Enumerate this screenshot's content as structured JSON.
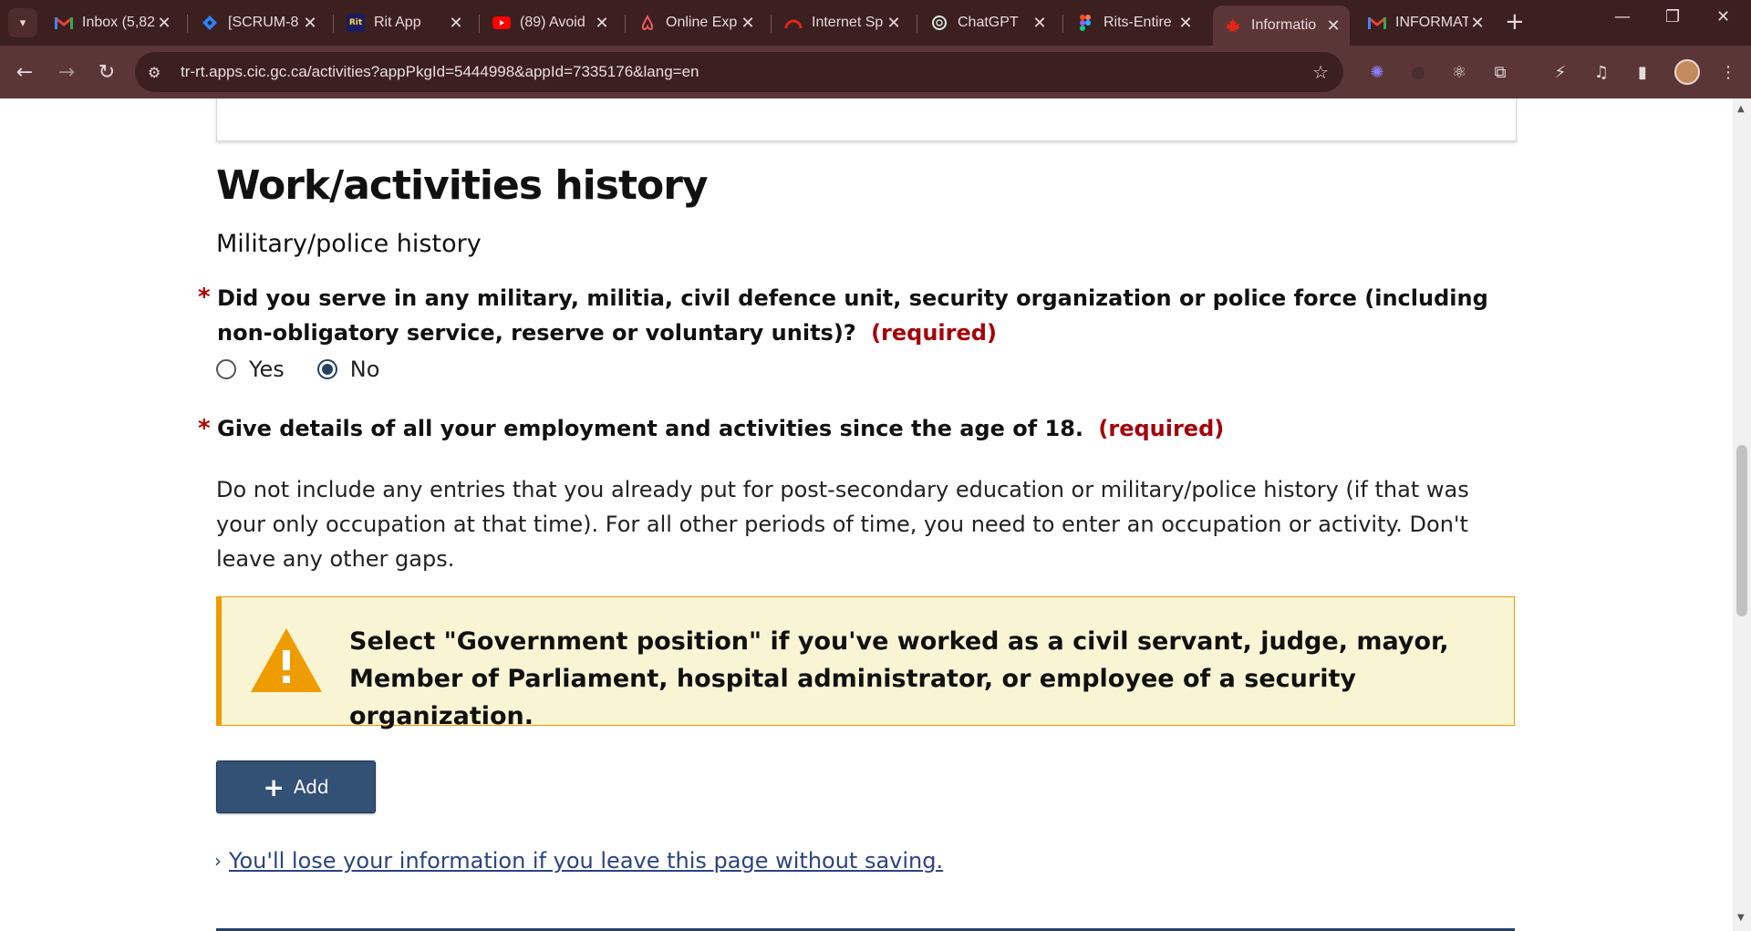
{
  "browser": {
    "tabs": [
      {
        "title": "Inbox (5,82",
        "icon": "gmail-icon",
        "active": false
      },
      {
        "title": "[SCRUM-8",
        "icon": "jira-icon",
        "active": false
      },
      {
        "title": "Rit App",
        "icon": "rit-icon",
        "active": false
      },
      {
        "title": "(89) Avoid",
        "icon": "youtube-icon",
        "active": false
      },
      {
        "title": "Online Exp",
        "icon": "airbnb-icon",
        "active": false
      },
      {
        "title": "Internet Sp",
        "icon": "speedtest-icon",
        "active": false
      },
      {
        "title": "ChatGPT",
        "icon": "chatgpt-icon",
        "active": false
      },
      {
        "title": "Rits-Entire",
        "icon": "figma-icon",
        "active": false
      },
      {
        "title": "Informatio",
        "icon": "maple-leaf-icon",
        "active": true
      },
      {
        "title": "INFORMAT",
        "icon": "gmail-icon",
        "active": false
      }
    ],
    "rit_favicon_text": "Rit",
    "url": "tr-rt.apps.cic.gc.ca/activities?appPkgId=5444998&appId=7335176&lang=en"
  },
  "page": {
    "heading": "Work/activities history",
    "subheading": "Military/police history",
    "required_marker": "*",
    "required_label": "(required)",
    "q1": {
      "text": "Did you serve in any military, militia, civil defence unit, security organization or police force (including non-obligatory service, reserve or voluntary units)?",
      "options": [
        "Yes",
        "No"
      ],
      "selected": "No"
    },
    "q2": {
      "text": "Give details of all your employment and activities since the age of 18."
    },
    "instructions": "Do not include any entries that you already put for post-secondary education or military/police history (if that was your only occupation at that time). For all other periods of time, you need to enter an occupation or activity. Don't leave any other gaps.",
    "warning": "Select \"Government position\" if you've worked as a civil servant, judge, mayor, Member of Parliament, hospital administrator, or employee of a security organization.",
    "add_button": "Add",
    "leave_link": "You'll lose your information if you leave this page without saving."
  },
  "colors": {
    "browser_frame": "#3c1f1f",
    "toolbar": "#5b3636",
    "required_red": "#a3000a",
    "button_blue": "#335075",
    "warning_bg": "#f9f4d4",
    "warning_border": "#ee9c00"
  }
}
